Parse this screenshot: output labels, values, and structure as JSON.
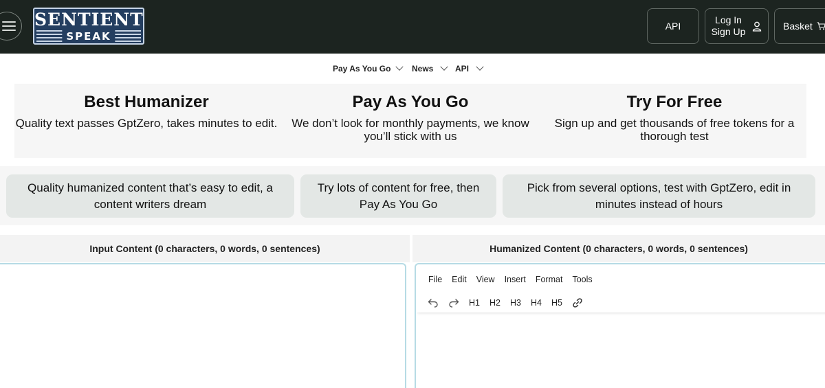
{
  "header": {
    "logo_top": "SENTIENT",
    "logo_bottom": "SPEAK",
    "api_label": "API",
    "login_label": "Log In",
    "signup_label": "Sign Up",
    "basket_label": "Basket",
    "icons": [
      "menu-icon",
      "user-icon",
      "cart-icon"
    ]
  },
  "nav": {
    "items": [
      {
        "label": "Pay As You Go"
      },
      {
        "label": "News"
      },
      {
        "label": "API"
      }
    ]
  },
  "features": [
    {
      "title": "Best Humanizer",
      "desc": "Quality text passes GptZero, takes minutes to edit."
    },
    {
      "title": "Pay As You Go",
      "desc": "We don’t look for monthly payments, we know you’ll stick with us"
    },
    {
      "title": "Try For Free",
      "desc": "Sign up and get thousands of free tokens for a thorough test"
    }
  ],
  "pills": [
    {
      "text": "Quality humanized content that’s easy to edit, a content writers dream"
    },
    {
      "text": "Try lots of content for free, then Pay As You Go"
    },
    {
      "text": "Pick from several options, test with GptZero, edit in minutes instead of hours"
    }
  ],
  "input_panel": {
    "heading": "Input Content (0 characters, 0 words, 0 sentences)"
  },
  "output_panel": {
    "heading": "Humanized Content (0 characters, 0 words, 0 sentences)",
    "menu": [
      "File",
      "Edit",
      "View",
      "Insert",
      "Format",
      "Tools"
    ],
    "toolbar": {
      "h1": "H1",
      "h2": "H2",
      "h3": "H3",
      "h4": "H4",
      "h5": "H5",
      "icons": [
        "undo-icon",
        "redo-icon",
        "link-icon"
      ]
    }
  },
  "colors": {
    "header_bg": "#1c2420",
    "logo_bg": "#243e60",
    "pill_bg": "#e3e7e5",
    "editor_border": "#b6dbe5"
  }
}
